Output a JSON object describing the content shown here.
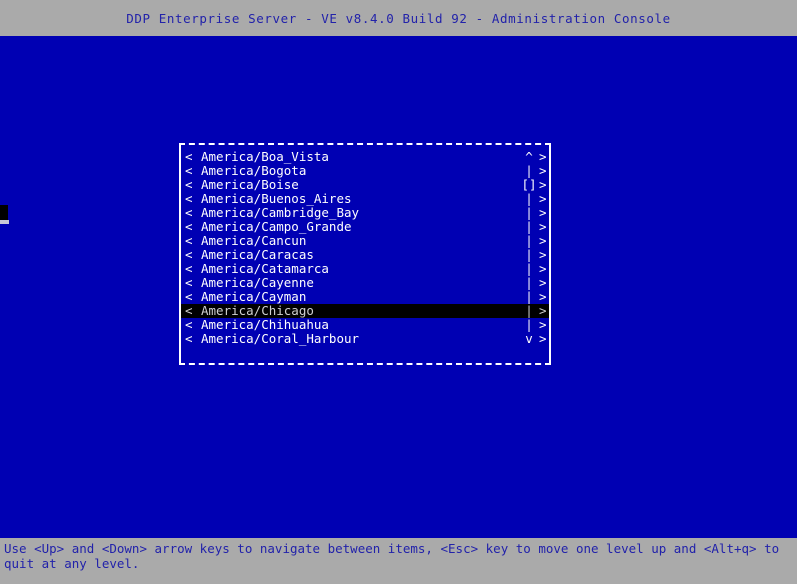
{
  "titlebar": {
    "title": "DDP Enterprise Server - VE v8.4.0 Build 92 - Administration Console"
  },
  "colors": {
    "console_background": "#0000b3",
    "chrome_background": "#aaaaaa",
    "text_primary": "#ffffff",
    "text_chrome": "#2222aa",
    "selection_background": "#000000",
    "selection_text": "#d0d0d0",
    "border": "#ffffff"
  },
  "cursor": {
    "glyph": "block-cursor"
  },
  "menu": {
    "title": "",
    "left_arrow_glyph": "<",
    "right_arrow_glyph": ">",
    "scroll_up_glyph": "^",
    "scroll_down_glyph": "v",
    "scroll_track_glyph": "|",
    "scroll_thumb_glyph": "[]",
    "selected_index": 11,
    "items": [
      {
        "label": "America/Boa_Vista",
        "scroll": "^",
        "selected": false
      },
      {
        "label": "America/Bogota",
        "scroll": "|",
        "selected": false
      },
      {
        "label": "America/Boise",
        "scroll": "[]",
        "selected": false
      },
      {
        "label": "America/Buenos_Aires",
        "scroll": "|",
        "selected": false
      },
      {
        "label": "America/Cambridge_Bay",
        "scroll": "|",
        "selected": false
      },
      {
        "label": "America/Campo_Grande",
        "scroll": "|",
        "selected": false
      },
      {
        "label": "America/Cancun",
        "scroll": "|",
        "selected": false
      },
      {
        "label": "America/Caracas",
        "scroll": "|",
        "selected": false
      },
      {
        "label": "America/Catamarca",
        "scroll": "|",
        "selected": false
      },
      {
        "label": "America/Cayenne",
        "scroll": "|",
        "selected": false
      },
      {
        "label": "America/Cayman",
        "scroll": "|",
        "selected": false
      },
      {
        "label": "America/Chicago",
        "scroll": "|",
        "selected": true
      },
      {
        "label": "America/Chihuahua",
        "scroll": "|",
        "selected": false
      },
      {
        "label": "America/Coral_Harbour",
        "scroll": "v",
        "selected": false
      }
    ]
  },
  "statusbar": {
    "help_text": "Use <Up> and <Down> arrow keys to navigate between items, <Esc> key to move one level up and <Alt+q> to quit at any level."
  }
}
